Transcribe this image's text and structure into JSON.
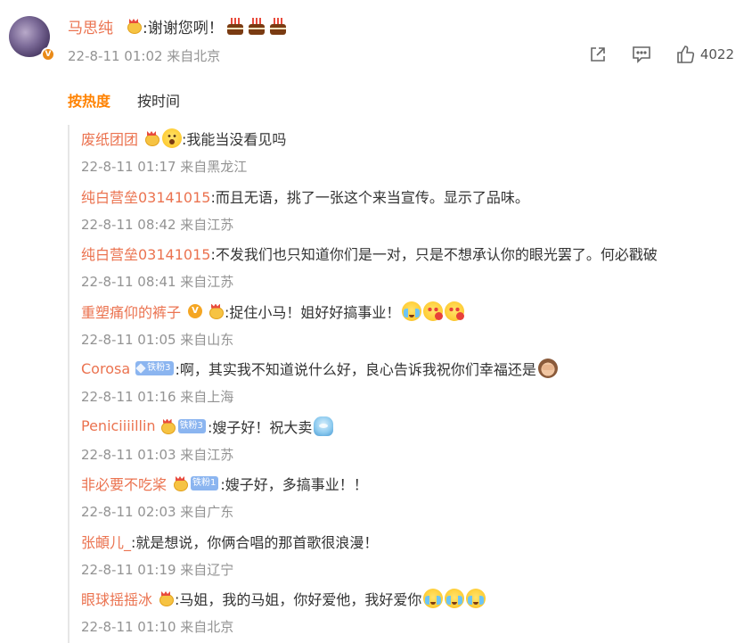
{
  "comment": {
    "username": "马思纯",
    "text": ":谢谢您咧！",
    "meta": "22-8-11 01:02 来自北京",
    "like_count": "4022",
    "icons": [
      "avatar",
      "vip-crown-icon",
      "birthday-cake-emoji",
      "share-icon",
      "comment-icon",
      "like-icon"
    ]
  },
  "sort": {
    "hot": "按热度",
    "time": "按时间"
  },
  "replies": [
    {
      "user": "废纸团团",
      "text": ":我能当没看见吗",
      "meta": "22-8-11 01:17 来自黑龙江"
    },
    {
      "user": "纯白营垒03141015",
      "text": ":而且无语，挑了一张这个来当宣传。显示了品味。",
      "meta": "22-8-11 08:42 来自江苏"
    },
    {
      "user": "纯白营垒03141015",
      "text": ":不发我们也只知道你们是一对，只是不想承认你的眼光罢了。何必戳破",
      "meta": "22-8-11 08:41 来自江苏"
    },
    {
      "user": "重塑痛仰的裤子",
      "text": ":捉住小马！姐好好搞事业！",
      "meta": "22-8-11 01:05 来自山东"
    },
    {
      "user": "Corosa",
      "badge": "铁粉3",
      "text": ":啊，其实我不知道说什么好，良心告诉我祝你们幸福还是",
      "meta": "22-8-11 01:16 来自上海"
    },
    {
      "user": "Peniciiiillin",
      "badge": "铁粉3",
      "text": ":嫂子好！祝大卖",
      "meta": "22-8-11 01:03 来自江苏"
    },
    {
      "user": "非必要不吃桨",
      "badge": "铁粉1",
      "text": ":嫂子好，多搞事业！！",
      "meta": "22-8-11 02:03 来自广东"
    },
    {
      "user": "张頔儿_",
      "text": ":就是想说，你俩合唱的那首歌很浪漫！",
      "meta": "22-8-11 01:19 来自辽宁"
    },
    {
      "user": "眼球摇摇冰",
      "text": ":马姐，我的马姐，你好爱他，我好爱你",
      "meta": "22-8-11 01:10 来自北京"
    }
  ]
}
